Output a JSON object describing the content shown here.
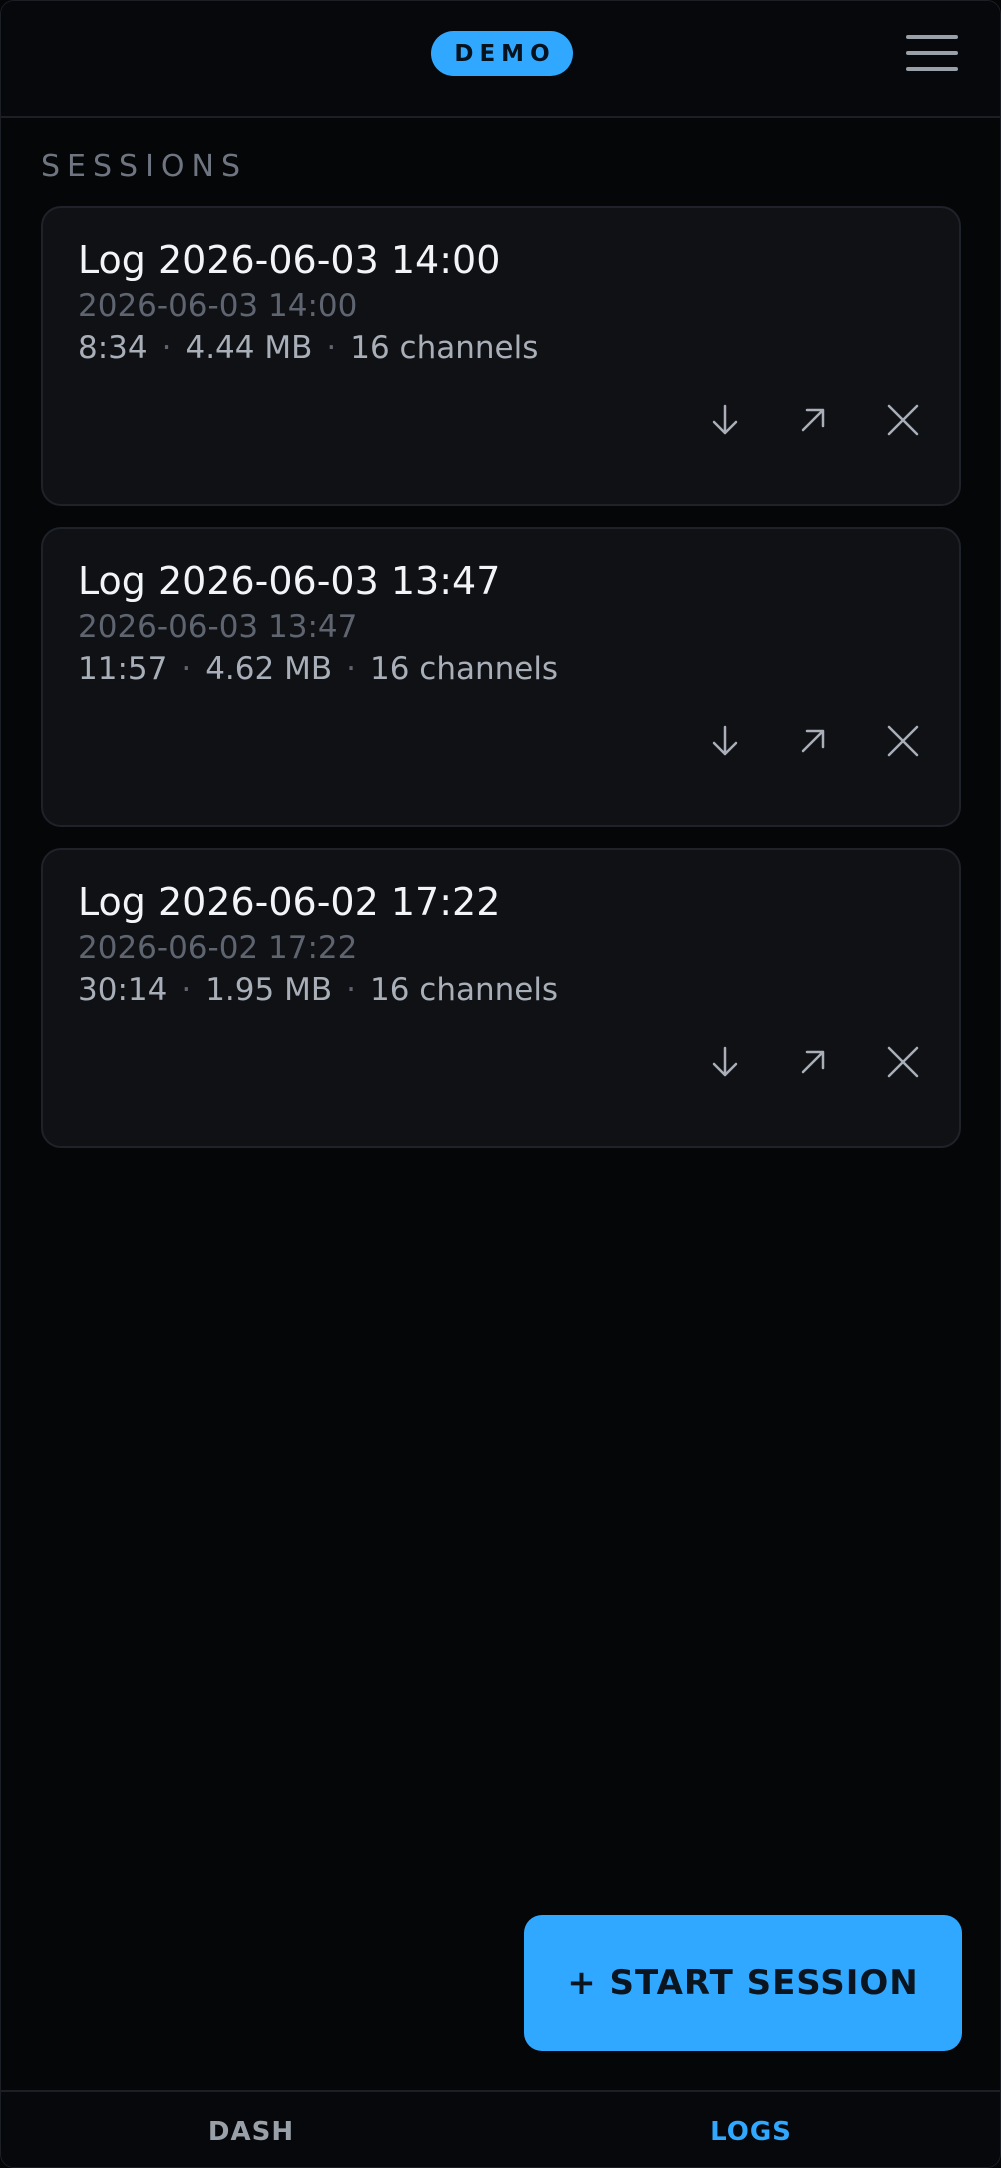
{
  "header": {
    "badge": "DEMO",
    "menu_icon": "hamburger-menu-icon"
  },
  "sessions": {
    "label": "SESSIONS",
    "items": [
      {
        "title": "Log 2026-06-03 14:00",
        "date": "2026-06-03 14:00",
        "duration": "8:34",
        "size": "4.44 MB",
        "channels": "16 channels"
      },
      {
        "title": "Log 2026-06-03 13:47",
        "date": "2026-06-03 13:47",
        "duration": "11:57",
        "size": "4.62 MB",
        "channels": "16 channels"
      },
      {
        "title": "Log 2026-06-02 17:22",
        "date": "2026-06-02 17:22",
        "duration": "30:14",
        "size": "1.95 MB",
        "channels": "16 channels"
      }
    ],
    "separator": "·",
    "action_icons": [
      "download-icon",
      "share-icon",
      "delete-icon"
    ]
  },
  "start_button": {
    "label": "+ START SESSION"
  },
  "nav": {
    "items": [
      {
        "label": "DASH",
        "active": false
      },
      {
        "label": "LOGS",
        "active": true
      }
    ]
  },
  "colors": {
    "accent": "#31a8ff",
    "background": "#050608",
    "card": "#0f1115"
  }
}
